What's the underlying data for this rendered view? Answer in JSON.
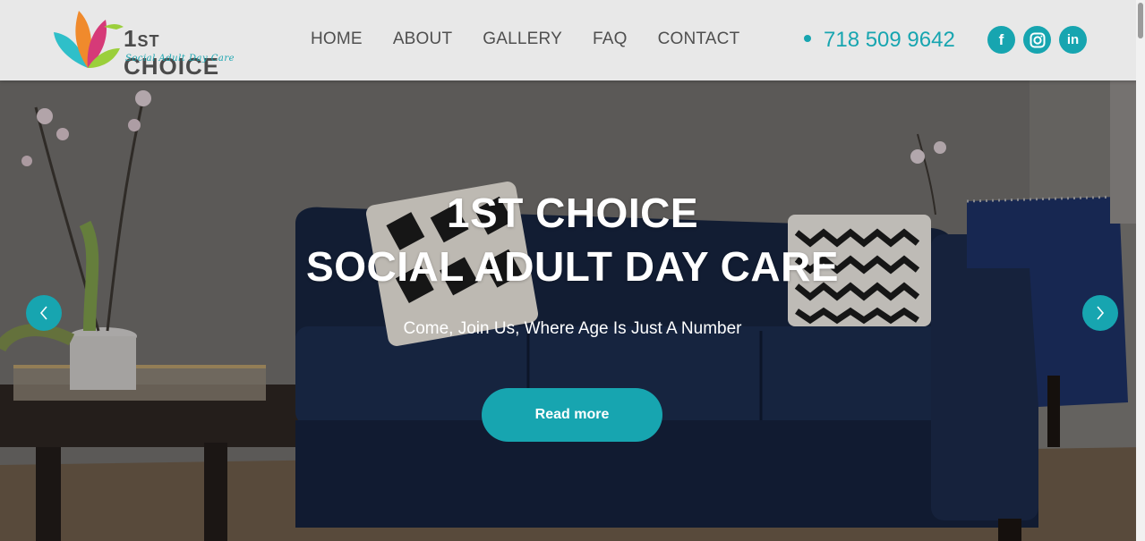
{
  "brand": {
    "name_big": "1",
    "name_small": "ST",
    "name_rest": " CHOICE",
    "tagline": "Social Adult Day Care"
  },
  "nav": {
    "items": [
      {
        "label": "HOME"
      },
      {
        "label": "ABOUT"
      },
      {
        "label": "GALLERY"
      },
      {
        "label": "FAQ"
      },
      {
        "label": "CONTACT"
      }
    ]
  },
  "contact": {
    "phone": "718 509 9642"
  },
  "social": {
    "items": [
      {
        "icon": "facebook-icon",
        "glyph": "f"
      },
      {
        "icon": "instagram-icon",
        "glyph": ""
      },
      {
        "icon": "linkedin-icon",
        "glyph": "in"
      }
    ]
  },
  "hero": {
    "title_line1": "1ST CHOICE",
    "title_line2": "SOCIAL ADULT DAY CARE",
    "subtitle": "Come, Join Us, Where Age Is Just A Number",
    "button_label": "Read more"
  },
  "colors": {
    "accent": "#17a5b0",
    "header_bg": "#e8e8e8",
    "nav_text": "#4f4f4f"
  }
}
